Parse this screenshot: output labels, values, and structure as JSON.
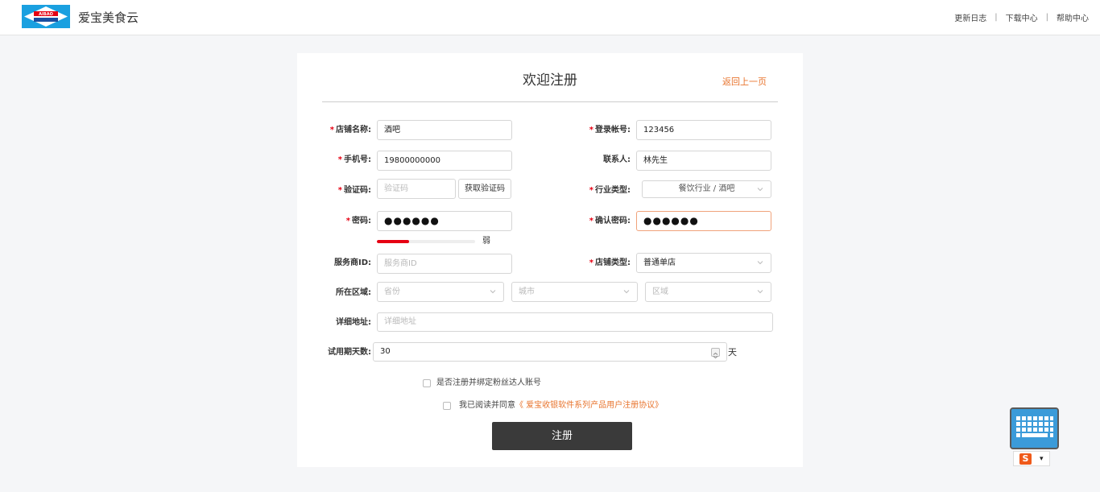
{
  "header": {
    "brand": "爱宝美食云",
    "logo_text": "AIBAO",
    "links": [
      "更新日志",
      "下载中心",
      "帮助中心"
    ],
    "separator": "|"
  },
  "form": {
    "title": "欢迎注册",
    "back_link": "返回上一页",
    "required_mark": "*",
    "fields": {
      "store_name": {
        "label": "店铺名称:",
        "value": "酒吧"
      },
      "login_account": {
        "label": "登录帐号:",
        "value": "123456"
      },
      "phone": {
        "label": "手机号:",
        "value": "19800000000"
      },
      "contact": {
        "label": "联系人:",
        "value": "林先生"
      },
      "verify_code": {
        "label": "验证码:",
        "placeholder": "验证码",
        "button": "获取验证码"
      },
      "industry": {
        "label": "行业类型:",
        "value": "餐饮行业 / 酒吧"
      },
      "password": {
        "label": "密码:",
        "value": "●●●●●●",
        "strength_text": "弱",
        "strength_fraction": 0.33
      },
      "confirm_password": {
        "label": "确认密码:",
        "value": "●●●●●●"
      },
      "provider_id": {
        "label": "服务商ID:",
        "placeholder": "服务商ID"
      },
      "store_type": {
        "label": "店铺类型:",
        "value": "普通单店"
      },
      "region": {
        "label": "所在区域:",
        "province": "省份",
        "city": "城市",
        "district": "区域"
      },
      "address": {
        "label": "详细地址:",
        "placeholder": "详细地址"
      },
      "trial_days": {
        "label": "试用期天数:",
        "value": "30",
        "unit": "天"
      }
    },
    "bind_fans": {
      "label": "是否注册并绑定粉丝达人账号",
      "checked": false
    },
    "agreement": {
      "prefix": "我已阅读并同意",
      "link": "《 爱宝收银软件系列产品用户注册协议》",
      "checked": false
    },
    "submit": "注册"
  },
  "ime": {
    "logo": "S",
    "arrow": "▾"
  },
  "colors": {
    "accent": "#e8752f",
    "required": "#e60012",
    "submit_bg": "#3a3a3a",
    "logo_blue": "#1aa0e0"
  }
}
